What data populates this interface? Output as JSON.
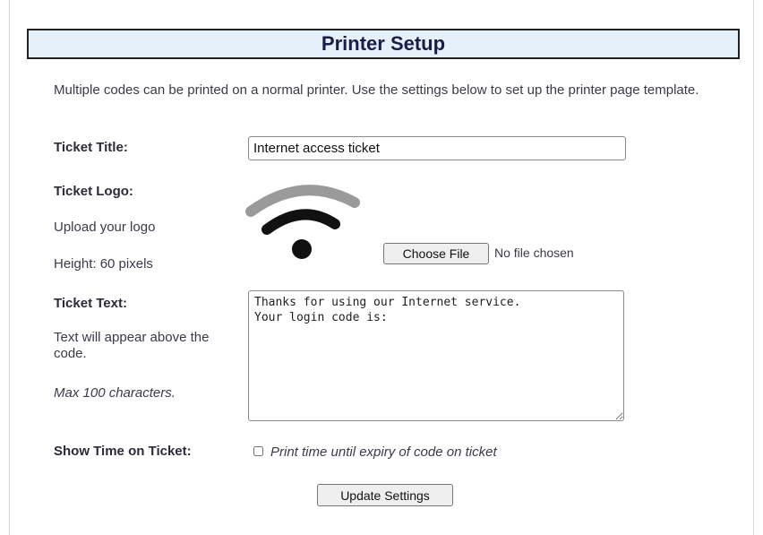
{
  "header": {
    "title": "Printer Setup"
  },
  "intro": "Multiple codes can be printed on a normal printer. Use the settings below to set up the printer page template.",
  "ticket_title": {
    "label": "Ticket Title:",
    "value": "Internet access ticket"
  },
  "ticket_logo": {
    "label": "Ticket Logo:",
    "upload_hint": "Upload your logo",
    "height_hint": "Height: 60 pixels",
    "logo_icon": "wifi-icon",
    "choose_file_label": "Choose File",
    "file_status": "No file chosen"
  },
  "ticket_text": {
    "label": "Ticket Text:",
    "hint": "Text will appear above the code.",
    "limit": "Max 100 characters.",
    "value": "Thanks for using our Internet service.\nYour login code is:"
  },
  "show_time": {
    "label": "Show Time on Ticket:",
    "checkbox_label": "Print time until expiry of code on ticket",
    "checked": false
  },
  "actions": {
    "update_label": "Update Settings"
  },
  "colors": {
    "title_bg": "#e4f1fa",
    "title_text": "#1c1c4a",
    "wifi_outer": "#9a9a9a",
    "wifi_inner": "#111111"
  }
}
